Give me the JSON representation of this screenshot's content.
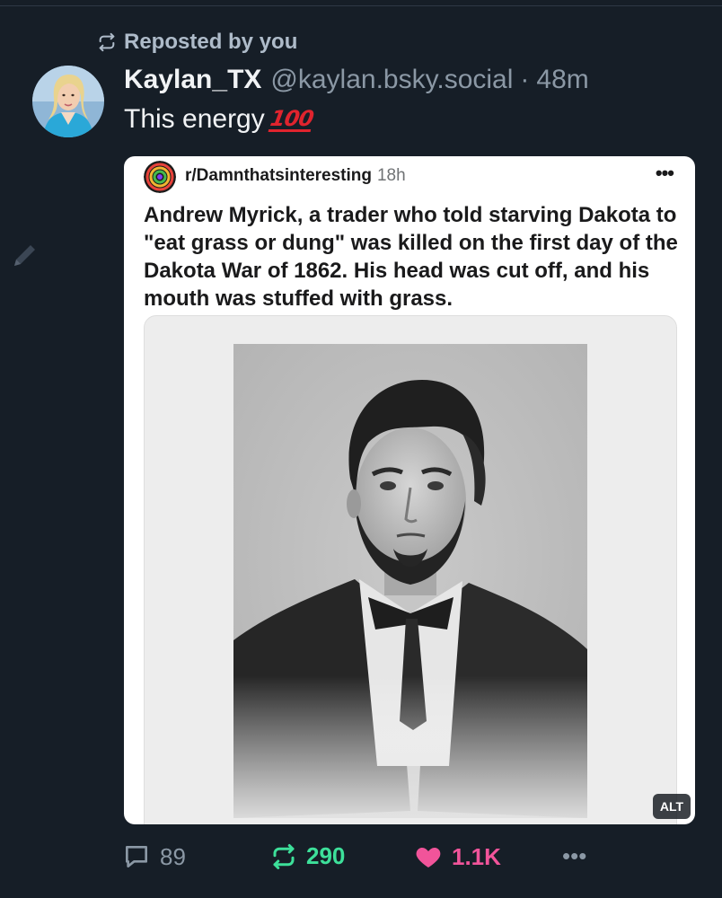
{
  "repost_banner": {
    "icon": "repost-icon",
    "text": "Reposted by you"
  },
  "post": {
    "author": {
      "display_name": "Kaylan_TX",
      "handle": "@kaylan.bsky.social",
      "separator": "·",
      "time_ago": "48m"
    },
    "text": "This energy",
    "emoji": "hundred-points-icon",
    "emoji_text": "100"
  },
  "embed": {
    "subreddit": "r/Damnthatsinteresting",
    "time_ago": "18h",
    "more_label": "•••",
    "title": "Andrew Myrick, a trader who told starving Dakota to \"eat grass or dung\" was killed on the first day of the Dakota War of 1862. His head was cut off, and his mouth was stuffed with grass.",
    "image_alt_badge": "ALT"
  },
  "actions": {
    "reply_count": "89",
    "repost_count": "290",
    "like_count": "1.1K",
    "more_label": "•••"
  },
  "colors": {
    "background": "#161e27",
    "repost_active": "#3de09a",
    "like_active": "#f1549a",
    "muted": "#8b98a5"
  }
}
